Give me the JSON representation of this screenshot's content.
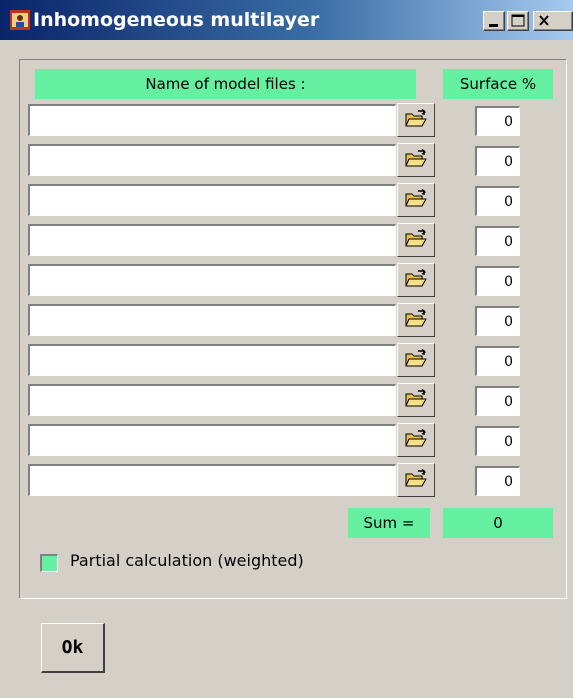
{
  "window": {
    "title": "Inhomogeneous multilayer",
    "icon": "app-icon",
    "controls": [
      "minimize-icon",
      "maximize-icon",
      "close-icon"
    ]
  },
  "table": {
    "header_files": "Name of model files :",
    "header_surface": "Surface %",
    "rows": [
      {
        "file": "",
        "surface": "0"
      },
      {
        "file": "",
        "surface": "0"
      },
      {
        "file": "",
        "surface": "0"
      },
      {
        "file": "",
        "surface": "0"
      },
      {
        "file": "",
        "surface": "0"
      },
      {
        "file": "",
        "surface": "0"
      },
      {
        "file": "",
        "surface": "0"
      },
      {
        "file": "",
        "surface": "0"
      },
      {
        "file": "",
        "surface": "0"
      },
      {
        "file": "",
        "surface": "0"
      }
    ],
    "browse_icon": "open-folder-icon"
  },
  "sum": {
    "label": "Sum =",
    "value": "0"
  },
  "partial": {
    "label": "Partial calculation (weighted)",
    "checked": false
  },
  "ok_label": "Ok",
  "colors": {
    "accent_green": "#64f0a0",
    "dialog_bg": "#d4d0c8",
    "title_blue": "#0a246a"
  }
}
